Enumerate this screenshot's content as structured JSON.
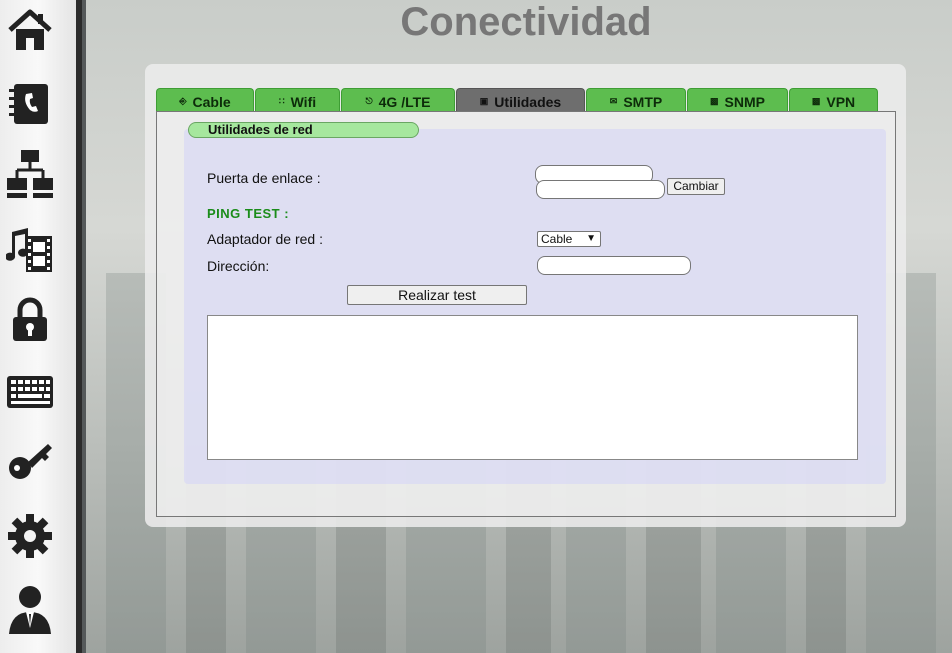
{
  "page": {
    "title": "Conectividad"
  },
  "sidebar": {
    "items": [
      {
        "name": "home-icon"
      },
      {
        "name": "phone-book-icon"
      },
      {
        "name": "network-icon"
      },
      {
        "name": "multimedia-icon"
      },
      {
        "name": "lock-icon"
      },
      {
        "name": "keyboard-icon"
      },
      {
        "name": "key-icon"
      },
      {
        "name": "gear-icon"
      },
      {
        "name": "user-icon"
      }
    ]
  },
  "tabs": [
    {
      "label": "Cable",
      "icon": "cable-icon"
    },
    {
      "label": "Wifi",
      "icon": "wifi-icon"
    },
    {
      "label": "4G /LTE",
      "icon": "lte-icon"
    },
    {
      "label": "Utilidades",
      "icon": "utilities-icon",
      "active": true
    },
    {
      "label": "SMTP",
      "icon": "mail-icon"
    },
    {
      "label": "SNMP",
      "icon": "document-icon"
    },
    {
      "label": "VPN",
      "icon": "document-icon"
    }
  ],
  "section": {
    "title": "Utilidades de red"
  },
  "gateway": {
    "label": "Puerta de enlace :",
    "value": "",
    "value_new": "",
    "button": "Cambiar"
  },
  "ping": {
    "heading": "PING TEST :",
    "adapter_label": "Adaptador de red :",
    "adapter_selected": "Cable",
    "address_label": "Dirección:",
    "address_value": "",
    "run_button": "Realizar test",
    "output": ""
  },
  "colors": {
    "tab_green": "#5dbd4f",
    "tab_active": "#6e6e6e",
    "pill_green": "#a6e79e",
    "ping_heading": "#1a8c1a",
    "title_gray": "#777777"
  }
}
